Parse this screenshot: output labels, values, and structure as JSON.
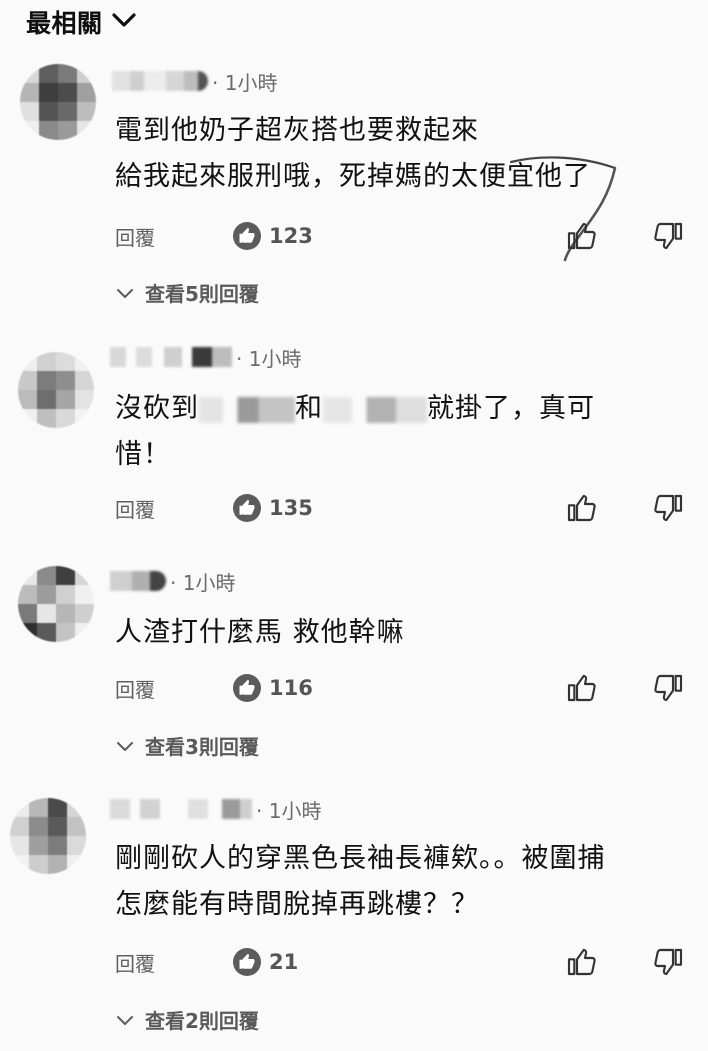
{
  "sort": {
    "label": "最相關",
    "icon": "chevron-down-icon"
  },
  "reply_label": "回覆",
  "comments": [
    {
      "time": "· 1小時",
      "text_line1": "電到他奶子超灰搭也要救起來",
      "text_line2": "給我起來服刑哦，死掉媽的太便宜他了",
      "likes": "123",
      "view_replies": "查看5則回覆"
    },
    {
      "time": "· 1小時",
      "text_a": "沒砍到",
      "text_b": "和",
      "text_c": "就掛了，真可",
      "text_line2": "惜！",
      "likes": "135"
    },
    {
      "time": "· 1小時",
      "text_line1": "人渣打什麼馬 救他幹嘛",
      "likes": "116",
      "view_replies": "查看3則回覆"
    },
    {
      "time": "· 1小時",
      "text_line1": "剛剛砍人的穿黑色長袖長褲欸。。被圍捕",
      "text_line2": "怎麼能有時間脫掉再跳樓？？",
      "likes": "21",
      "view_replies": "查看2則回覆"
    }
  ],
  "colors": {
    "background": "#fafafa",
    "text": "#111111",
    "secondary": "#606060",
    "icon_fill": "#5c5c5c"
  }
}
